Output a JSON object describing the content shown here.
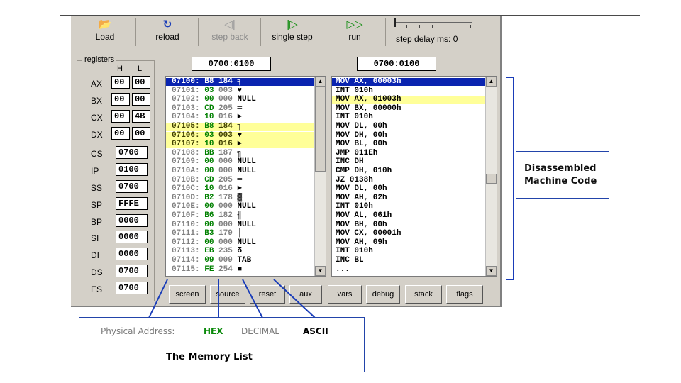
{
  "toolbar": {
    "load": "Load",
    "reload": "reload",
    "step_back": "step back",
    "single_step": "single step",
    "run": "run",
    "step_delay": "step delay ms: 0"
  },
  "registers": {
    "title": "registers",
    "h": "H",
    "l": "L",
    "split": [
      {
        "name": "AX",
        "h": "00",
        "l": "00"
      },
      {
        "name": "BX",
        "h": "00",
        "l": "00"
      },
      {
        "name": "CX",
        "h": "00",
        "l": "4B"
      },
      {
        "name": "DX",
        "h": "00",
        "l": "00"
      }
    ],
    "full": [
      {
        "name": "CS",
        "value": "0700"
      },
      {
        "name": "IP",
        "value": "0100"
      },
      {
        "name": "SS",
        "value": "0700"
      },
      {
        "name": "SP",
        "value": "FFFE"
      },
      {
        "name": "BP",
        "value": "0000"
      },
      {
        "name": "SI",
        "value": "0000"
      },
      {
        "name": "DI",
        "value": "0000"
      },
      {
        "name": "DS",
        "value": "0700"
      },
      {
        "name": "ES",
        "value": "0700"
      }
    ]
  },
  "memory": {
    "address": "0700:0100",
    "rows": [
      {
        "addr": "07100:",
        "hex": "B8",
        "dec": "184",
        "ascii": "╕",
        "state": "selected"
      },
      {
        "addr": "07101:",
        "hex": "03",
        "dec": "003",
        "ascii": "♥",
        "state": ""
      },
      {
        "addr": "07102:",
        "hex": "00",
        "dec": "000",
        "ascii": "NULL",
        "state": ""
      },
      {
        "addr": "07103:",
        "hex": "CD",
        "dec": "205",
        "ascii": "═",
        "state": ""
      },
      {
        "addr": "07104:",
        "hex": "10",
        "dec": "016",
        "ascii": "►",
        "state": ""
      },
      {
        "addr": "07105:",
        "hex": "B8",
        "dec": "184",
        "ascii": "╕",
        "state": "highlight"
      },
      {
        "addr": "07106:",
        "hex": "03",
        "dec": "003",
        "ascii": "♥",
        "state": "highlight"
      },
      {
        "addr": "07107:",
        "hex": "10",
        "dec": "016",
        "ascii": "►",
        "state": "highlight"
      },
      {
        "addr": "07108:",
        "hex": "BB",
        "dec": "187",
        "ascii": "╗",
        "state": ""
      },
      {
        "addr": "07109:",
        "hex": "00",
        "dec": "000",
        "ascii": "NULL",
        "state": ""
      },
      {
        "addr": "0710A:",
        "hex": "00",
        "dec": "000",
        "ascii": "NULL",
        "state": ""
      },
      {
        "addr": "0710B:",
        "hex": "CD",
        "dec": "205",
        "ascii": "═",
        "state": ""
      },
      {
        "addr": "0710C:",
        "hex": "10",
        "dec": "016",
        "ascii": "►",
        "state": ""
      },
      {
        "addr": "0710D:",
        "hex": "B2",
        "dec": "178",
        "ascii": "▓",
        "state": ""
      },
      {
        "addr": "0710E:",
        "hex": "00",
        "dec": "000",
        "ascii": "NULL",
        "state": ""
      },
      {
        "addr": "0710F:",
        "hex": "B6",
        "dec": "182",
        "ascii": "╢",
        "state": ""
      },
      {
        "addr": "07110:",
        "hex": "00",
        "dec": "000",
        "ascii": "NULL",
        "state": ""
      },
      {
        "addr": "07111:",
        "hex": "B3",
        "dec": "179",
        "ascii": "│",
        "state": ""
      },
      {
        "addr": "07112:",
        "hex": "00",
        "dec": "000",
        "ascii": "NULL",
        "state": ""
      },
      {
        "addr": "07113:",
        "hex": "EB",
        "dec": "235",
        "ascii": "δ",
        "state": ""
      },
      {
        "addr": "07114:",
        "hex": "09",
        "dec": "009",
        "ascii": "TAB",
        "state": ""
      },
      {
        "addr": "07115:",
        "hex": "FE",
        "dec": "254",
        "ascii": "■",
        "state": ""
      }
    ]
  },
  "disassembly": {
    "address": "0700:0100",
    "rows": [
      {
        "text": "MOV AX, 00003h",
        "state": "selected"
      },
      {
        "text": "INT 010h",
        "state": ""
      },
      {
        "text": "MOV AX, 01003h",
        "state": "highlight"
      },
      {
        "text": "MOV BX, 00000h",
        "state": ""
      },
      {
        "text": "INT 010h",
        "state": ""
      },
      {
        "text": "MOV DL, 00h",
        "state": ""
      },
      {
        "text": "MOV DH, 00h",
        "state": ""
      },
      {
        "text": "MOV BL, 00h",
        "state": ""
      },
      {
        "text": "JMP 011Eh",
        "state": ""
      },
      {
        "text": "INC DH",
        "state": ""
      },
      {
        "text": "CMP DH, 010h",
        "state": ""
      },
      {
        "text": "JZ 0138h",
        "state": ""
      },
      {
        "text": "MOV DL, 00h",
        "state": ""
      },
      {
        "text": "MOV AH, 02h",
        "state": ""
      },
      {
        "text": "INT 010h",
        "state": ""
      },
      {
        "text": "MOV AL, 061h",
        "state": ""
      },
      {
        "text": "MOV BH, 00h",
        "state": ""
      },
      {
        "text": "MOV CX, 00001h",
        "state": ""
      },
      {
        "text": "MOV AH, 09h",
        "state": ""
      },
      {
        "text": "INT 010h",
        "state": ""
      },
      {
        "text": "INC BL",
        "state": ""
      },
      {
        "text": "...",
        "state": ""
      }
    ]
  },
  "bottom_buttons": [
    "screen",
    "source",
    "reset",
    "aux",
    "vars",
    "debug",
    "stack",
    "flags"
  ],
  "annotations": {
    "disassembled": "Disassembled Machine Code",
    "physical_address": "Physical Address:",
    "hex": "HEX",
    "decimal": "DECIMAL",
    "ascii": "ASCII",
    "memory_list": "The Memory List"
  },
  "colors": {
    "selection": "#0a24b0",
    "highlight": "#ffff99",
    "hex_text": "#008000",
    "annotation_line": "#1a3db8"
  }
}
